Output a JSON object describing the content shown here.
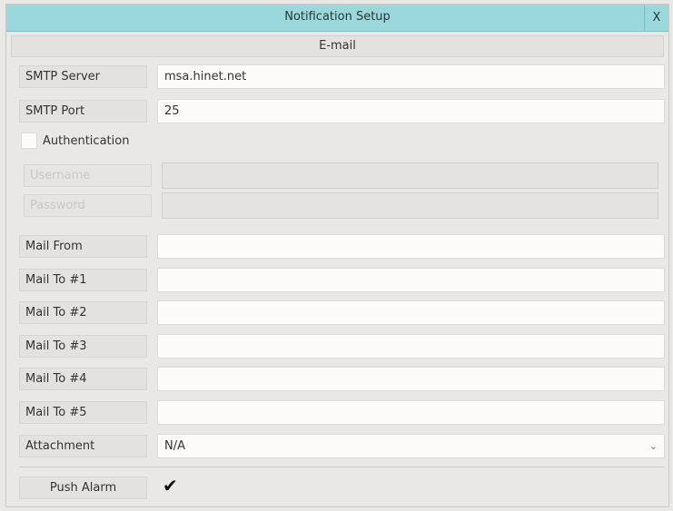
{
  "window": {
    "title": "Notification Setup",
    "close_label": "X"
  },
  "section": {
    "title": "E-mail"
  },
  "smtp_server": {
    "label": "SMTP Server",
    "value": "msa.hinet.net"
  },
  "smtp_port": {
    "label": "SMTP Port",
    "value": "25"
  },
  "authentication": {
    "label": "Authentication",
    "checked": false
  },
  "username": {
    "label": "Username",
    "value": ""
  },
  "password": {
    "label": "Password",
    "value": ""
  },
  "mail_from": {
    "label": "Mail From",
    "value": ""
  },
  "mail_to": [
    {
      "label": "Mail To #1",
      "value": ""
    },
    {
      "label": "Mail To #2",
      "value": ""
    },
    {
      "label": "Mail To #3",
      "value": ""
    },
    {
      "label": "Mail To #4",
      "value": ""
    },
    {
      "label": "Mail To #5",
      "value": ""
    }
  ],
  "attachment": {
    "label": "Attachment",
    "value": "N/A",
    "arrow_icon": "chevron-down-icon"
  },
  "push_alarm": {
    "label": "Push Alarm",
    "checked": true,
    "check_glyph": "✔"
  },
  "colors": {
    "titlebar": "#9ad8dc",
    "background": "#e9e8e6"
  }
}
